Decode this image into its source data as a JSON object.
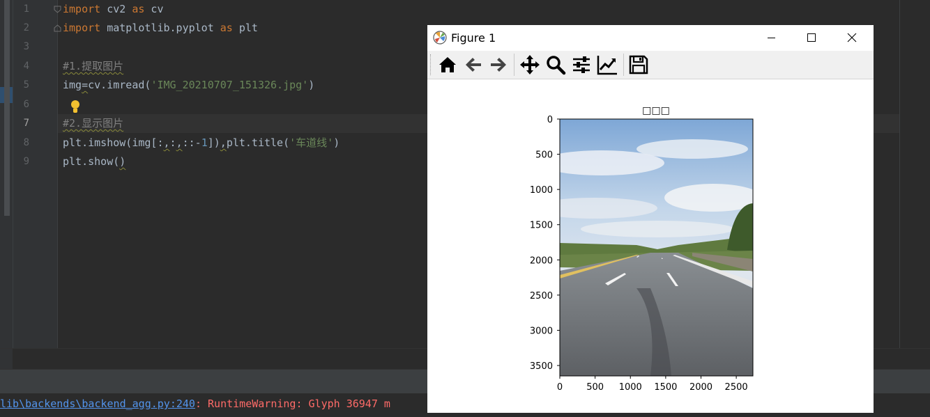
{
  "editor": {
    "line_numbers": [
      "1",
      "2",
      "3",
      "4",
      "5",
      "6",
      "7",
      "8",
      "9"
    ],
    "lines": {
      "l1": {
        "kw1": "import",
        "mod": " cv2 ",
        "kw2": "as",
        "alias": " cv"
      },
      "l2": {
        "kw1": "import",
        "mod": " matplotlib.pyplot ",
        "kw2": "as",
        "alias": " plt"
      },
      "l4": {
        "comment": "#1.提取图片"
      },
      "l5": {
        "var": "img",
        "eq": "=",
        "call": "cv.imread(",
        "str": "'IMG_20210707_151326.jpg'",
        "close": ")"
      },
      "l7": {
        "comment": "#2.显示图片"
      },
      "l8": {
        "p1": "plt.imshow(img[:",
        "c1": ",",
        "p2": ":",
        "c2": ",",
        "p3": "::-",
        "num": "1",
        "p4": "])",
        "c3": ",",
        "p5": "plt.title(",
        "str": "'车道线'",
        "p6": ")"
      },
      "l9": {
        "p1": "plt.show(",
        "p2": ")"
      }
    }
  },
  "console": {
    "link": "lib\\backends\\backend_agg.py:240",
    "message": ": RuntimeWarning: Glyph 36947 m"
  },
  "figure": {
    "window_title": "Figure 1",
    "toolbar": [
      "home-icon",
      "back-icon",
      "forward-icon",
      "pan-icon",
      "zoom-icon",
      "configure-subplots-icon",
      "edit-axes-icon",
      "save-icon"
    ]
  },
  "chart_data": {
    "type": "image",
    "title": "□□□",
    "x_ticks": [
      "0",
      "500",
      "1000",
      "1500",
      "2000",
      "2500"
    ],
    "y_ticks": [
      "0",
      "500",
      "1000",
      "1500",
      "2000",
      "2500",
      "3000",
      "3500"
    ],
    "xlim": [
      0,
      2736
    ],
    "ylim": [
      3648,
      0
    ],
    "image": "road photograph with lane markings under cloudy sky"
  }
}
